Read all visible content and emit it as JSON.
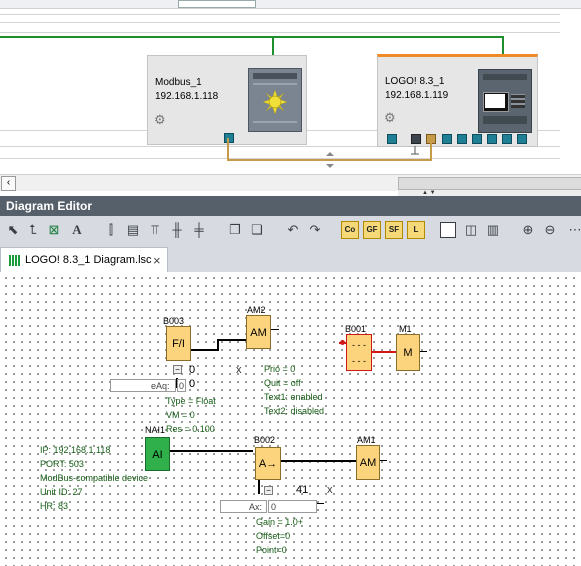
{
  "network": {
    "devices": [
      {
        "name": "Modbus_1",
        "ip": "192.168.1.118"
      },
      {
        "name": "LOGO! 8.3_1",
        "ip": "192.168.1.119"
      }
    ]
  },
  "editor": {
    "title": "Diagram Editor",
    "toolbar": {
      "co": "Co",
      "gf": "GF",
      "sf": "SF",
      "l": "L"
    },
    "tab": {
      "label": "LOGO! 8.3_1 Diagram.lsc",
      "close": "×"
    }
  },
  "diagram": {
    "b003": {
      "name": "B003",
      "symbol": "F/I"
    },
    "am2": {
      "name": "AM2",
      "symbol": "AM"
    },
    "b001": {
      "name": "B001",
      "symbol": "- - -\n- - -"
    },
    "m1": {
      "name": "M1",
      "symbol": "M"
    },
    "param1": {
      "value": "0",
      "close": "x",
      "field": "eAq:",
      "field_value": "0"
    },
    "b003_params": [
      "Type = Float",
      "VM = 0",
      "Res = 0.100"
    ],
    "am2_params": [
      "Prio = 0",
      "Quit = off",
      "Text1: enabled",
      "Text2: disabled"
    ],
    "nai1": {
      "name": "NAI1",
      "symbol": "AI"
    },
    "nai1_params": [
      "IP: 192.168.1.118",
      "PORT: 503",
      "ModBus-compatible device",
      "Unit ID: 27",
      "HR: 83"
    ],
    "b002": {
      "name": "B002",
      "symbol": "A→"
    },
    "am1": {
      "name": "AM1",
      "symbol": "AM"
    },
    "param2": {
      "value": "41",
      "close": "x",
      "field": "Ax:",
      "field_value": "0"
    },
    "b002_params": [
      "Gain = 1.0+",
      "Offset=0",
      "Point=0"
    ]
  }
}
